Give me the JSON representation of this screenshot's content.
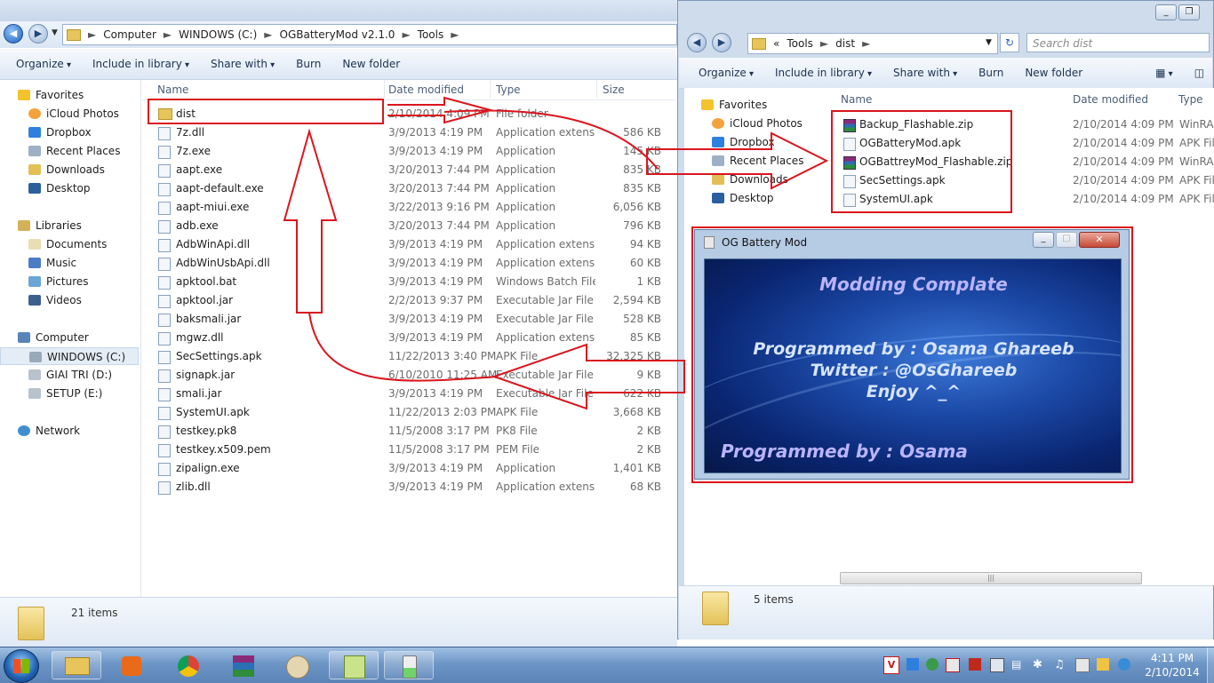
{
  "explorer1": {
    "breadcrumb": [
      "Computer",
      "WINDOWS (C:)",
      "OGBatteryMod v2.1.0",
      "Tools"
    ],
    "toolbar": [
      "Organize",
      "Include in library",
      "Share with",
      "Burn",
      "New folder"
    ],
    "columns": {
      "name": "Name",
      "date": "Date modified",
      "type": "Type",
      "size": "Size"
    },
    "nav": {
      "favorites": "Favorites",
      "favorites_items": [
        "iCloud Photos",
        "Dropbox",
        "Recent Places",
        "Downloads",
        "Desktop"
      ],
      "libraries": "Libraries",
      "libraries_items": [
        "Documents",
        "Music",
        "Pictures",
        "Videos"
      ],
      "computer": "Computer",
      "computer_items": [
        "WINDOWS (C:)",
        "GIAI TRI (D:)",
        "SETUP (E:)"
      ],
      "network": "Network"
    },
    "files": [
      {
        "name": "dist",
        "date": "2/10/2014 4:09 PM",
        "type": "File folder",
        "size": ""
      },
      {
        "name": "7z.dll",
        "date": "3/9/2013 4:19 PM",
        "type": "Application extens...",
        "size": "586 KB"
      },
      {
        "name": "7z.exe",
        "date": "3/9/2013 4:19 PM",
        "type": "Application",
        "size": "145 KB"
      },
      {
        "name": "aapt.exe",
        "date": "3/20/2013 7:44 PM",
        "type": "Application",
        "size": "835 KB"
      },
      {
        "name": "aapt-default.exe",
        "date": "3/20/2013 7:44 PM",
        "type": "Application",
        "size": "835 KB"
      },
      {
        "name": "aapt-miui.exe",
        "date": "3/22/2013 9:16 PM",
        "type": "Application",
        "size": "6,056 KB"
      },
      {
        "name": "adb.exe",
        "date": "3/20/2013 7:44 PM",
        "type": "Application",
        "size": "796 KB"
      },
      {
        "name": "AdbWinApi.dll",
        "date": "3/9/2013 4:19 PM",
        "type": "Application extens...",
        "size": "94 KB"
      },
      {
        "name": "AdbWinUsbApi.dll",
        "date": "3/9/2013 4:19 PM",
        "type": "Application extens...",
        "size": "60 KB"
      },
      {
        "name": "apktool.bat",
        "date": "3/9/2013 4:19 PM",
        "type": "Windows Batch File",
        "size": "1 KB"
      },
      {
        "name": "apktool.jar",
        "date": "2/2/2013 9:37 PM",
        "type": "Executable Jar File",
        "size": "2,594 KB"
      },
      {
        "name": "baksmali.jar",
        "date": "3/9/2013 4:19 PM",
        "type": "Executable Jar File",
        "size": "528 KB"
      },
      {
        "name": "mgwz.dll",
        "date": "3/9/2013 4:19 PM",
        "type": "Application extens...",
        "size": "85 KB"
      },
      {
        "name": "SecSettings.apk",
        "date": "11/22/2013 3:40 PM",
        "type": "APK File",
        "size": "32,325 KB"
      },
      {
        "name": "signapk.jar",
        "date": "6/10/2010 11:25 AM",
        "type": "Executable Jar File",
        "size": "9 KB"
      },
      {
        "name": "smali.jar",
        "date": "3/9/2013 4:19 PM",
        "type": "Executable Jar File",
        "size": "622 KB"
      },
      {
        "name": "SystemUI.apk",
        "date": "11/22/2013 2:03 PM",
        "type": "APK File",
        "size": "3,668 KB"
      },
      {
        "name": "testkey.pk8",
        "date": "11/5/2008 3:17 PM",
        "type": "PK8 File",
        "size": "2 KB"
      },
      {
        "name": "testkey.x509.pem",
        "date": "11/5/2008 3:17 PM",
        "type": "PEM File",
        "size": "2 KB"
      },
      {
        "name": "zipalign.exe",
        "date": "3/9/2013 4:19 PM",
        "type": "Application",
        "size": "1,401 KB"
      },
      {
        "name": "zlib.dll",
        "date": "3/9/2013 4:19 PM",
        "type": "Application extens...",
        "size": "68 KB"
      }
    ],
    "status": "21 items"
  },
  "explorer2": {
    "breadcrumb": [
      "«",
      "Tools",
      "dist"
    ],
    "search_placeholder": "Search dist",
    "toolbar": [
      "Organize",
      "Include in library",
      "Share with",
      "Burn",
      "New folder"
    ],
    "columns": {
      "name": "Name",
      "date": "Date modified",
      "type": "Type"
    },
    "nav": {
      "favorites": "Favorites",
      "items": [
        "iCloud Photos",
        "Dropbox",
        "Recent Places",
        "Downloads",
        "Desktop"
      ]
    },
    "files": [
      {
        "name": "Backup_Flashable.zip",
        "date": "2/10/2014 4:09 PM",
        "type": "WinRAR"
      },
      {
        "name": "OGBatteryMod.apk",
        "date": "2/10/2014 4:09 PM",
        "type": "APK File"
      },
      {
        "name": "OGBattreyMod_Flashable.zip",
        "date": "2/10/2014 4:09 PM",
        "type": "WinRAR"
      },
      {
        "name": "SecSettings.apk",
        "date": "2/10/2014 4:09 PM",
        "type": "APK File"
      },
      {
        "name": "SystemUI.apk",
        "date": "2/10/2014 4:09 PM",
        "type": "APK File"
      }
    ],
    "status": "5 items"
  },
  "dialog": {
    "title": "OG Battery Mod",
    "line1": "Modding Complate",
    "line2": "Programmed by : Osama Ghareeb",
    "line3": "Twitter : @OsGhareeb",
    "line4": "Enjoy ^_^",
    "footer": "Programmed by : Osama"
  },
  "taskbar": {
    "time": "4:11 PM",
    "date": "2/10/2014"
  },
  "colors": {
    "annotation_red": "#d9161e",
    "dialog_text_light": "#d6e4ff",
    "dialog_text_purple": "#b9b4ff"
  }
}
